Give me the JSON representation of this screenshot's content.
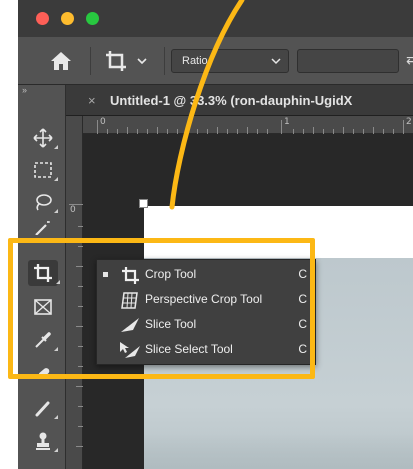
{
  "options_bar": {
    "ratio_label": "Ratio"
  },
  "document": {
    "tab_close": "×",
    "tab_title": "Untitled-1 @ 33.3% (ron-dauphin-UgidX"
  },
  "rulers": {
    "top_labels": [
      "0",
      "1",
      "2"
    ],
    "left_labels": [
      "0"
    ]
  },
  "flyout": {
    "items": [
      {
        "label": "Crop Tool",
        "shortcut": "C",
        "icon": "crop-icon",
        "active": true
      },
      {
        "label": "Perspective Crop Tool",
        "shortcut": "C",
        "icon": "perspective-crop-icon",
        "active": false
      },
      {
        "label": "Slice Tool",
        "shortcut": "C",
        "icon": "slice-icon",
        "active": false
      },
      {
        "label": "Slice Select Tool",
        "shortcut": "C",
        "icon": "slice-select-icon",
        "active": false
      }
    ]
  },
  "toolbar": {
    "tools": [
      "move-icon",
      "marquee-icon",
      "lasso-icon",
      "magic-wand-icon",
      "crop-icon",
      "frame-icon",
      "eyedropper-icon",
      "healing-brush-icon",
      "brush-icon",
      "clone-stamp-icon"
    ]
  },
  "colors": {
    "highlight": "#fcb815",
    "panel": "#535353",
    "app_background": "#3c3c3c",
    "mac_close": "#fe5f57",
    "mac_minimize": "#febc2e",
    "mac_maximize": "#28c840"
  }
}
